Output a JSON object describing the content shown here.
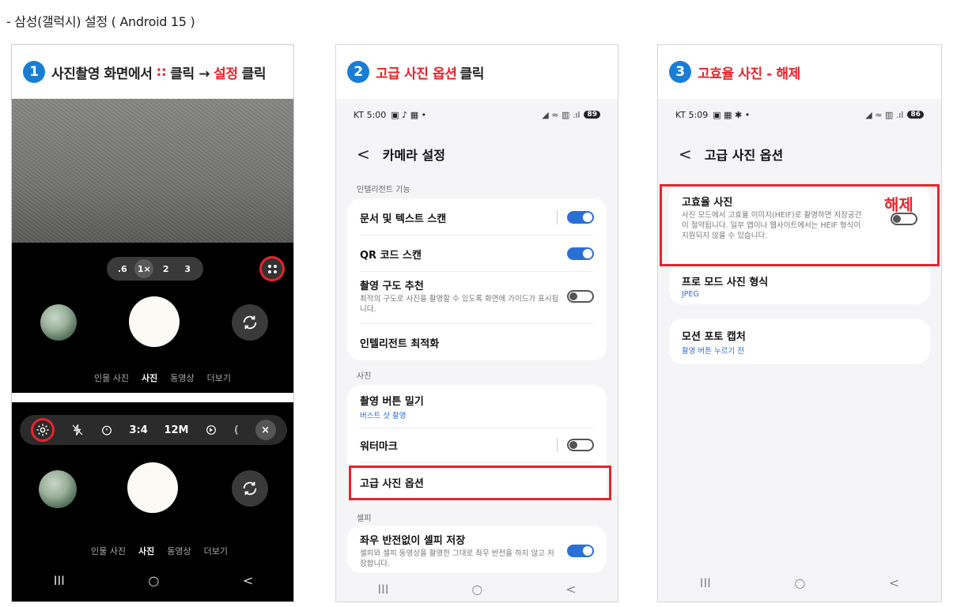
{
  "top_note": "- 삼성(갤럭시) 설정 ( Android 15 )",
  "step1": {
    "num": "1",
    "head_a": "사진촬영 화면에서 ",
    "head_b": "::",
    "head_c": " 클릭 → ",
    "head_d": "설정",
    "head_e": " 클릭",
    "zoom": [
      ".6",
      "1×",
      "2",
      "3"
    ],
    "modes": [
      "인물 사진",
      "사진",
      "동영상",
      "더보기"
    ],
    "settings_bar": [
      "3:4",
      "12M"
    ],
    "close": "×",
    "accent": "#e8232a"
  },
  "step2": {
    "num": "2",
    "head_a": "고급 사진 옵션",
    "head_b": " 클릭",
    "status_time": "KT 5:00",
    "battery": "89",
    "title": "카메라 설정",
    "back": "<",
    "sec1": "인텔리전트 기능",
    "sec2": "사진",
    "sec3": "셀피",
    "rows": {
      "doc_scan": "문서 및 텍스트 스캔",
      "qr_scan": "QR 코드 스캔",
      "comp_title": "촬영 구도 추천",
      "comp_sub": "최적의 구도로 사진을 촬영할 수 있도록 화면에 가이드가 표시됩니다.",
      "intel_opt": "인텔리전트 최적화",
      "swipe_title": "촬영 버튼 밀기",
      "swipe_sub": "버스트 샷 촬영",
      "watermark": "워터마크",
      "adv": "고급 사진 옵션",
      "selfie_title": "좌우 반전없이 셀피 저장",
      "selfie_sub": "셀피와 셀피 동영상을 촬영한 그대로 좌우 반전을 하지 않고 저장합니다."
    },
    "toggles": {
      "doc_scan": true,
      "qr_scan": true,
      "comp": false,
      "watermark": false,
      "selfie": true
    }
  },
  "step3": {
    "num": "3",
    "head_a": "고효율 사진 - 해제",
    "status_time": "KT 5:09",
    "battery": "86",
    "title": "고급 사진 옵션",
    "back": "<",
    "heif_title": "고효율 사진",
    "heif_sub": "사진 모드에서 고효율 이미지(HEIF)로 촬영하면 저장공간이 절약됩니다. 일부 앱이나 웹사이트에서는 HEIF 형식이 지원되지 않을 수 있습니다.",
    "release": "해제",
    "pro_title": "프로 모드 사진 형식",
    "pro_sub": "JPEG",
    "motion_title": "모션 포토 캡처",
    "motion_sub": "촬영 버튼 누르기 전",
    "heif_on": false
  },
  "nav": [
    "III",
    "○",
    "<"
  ]
}
